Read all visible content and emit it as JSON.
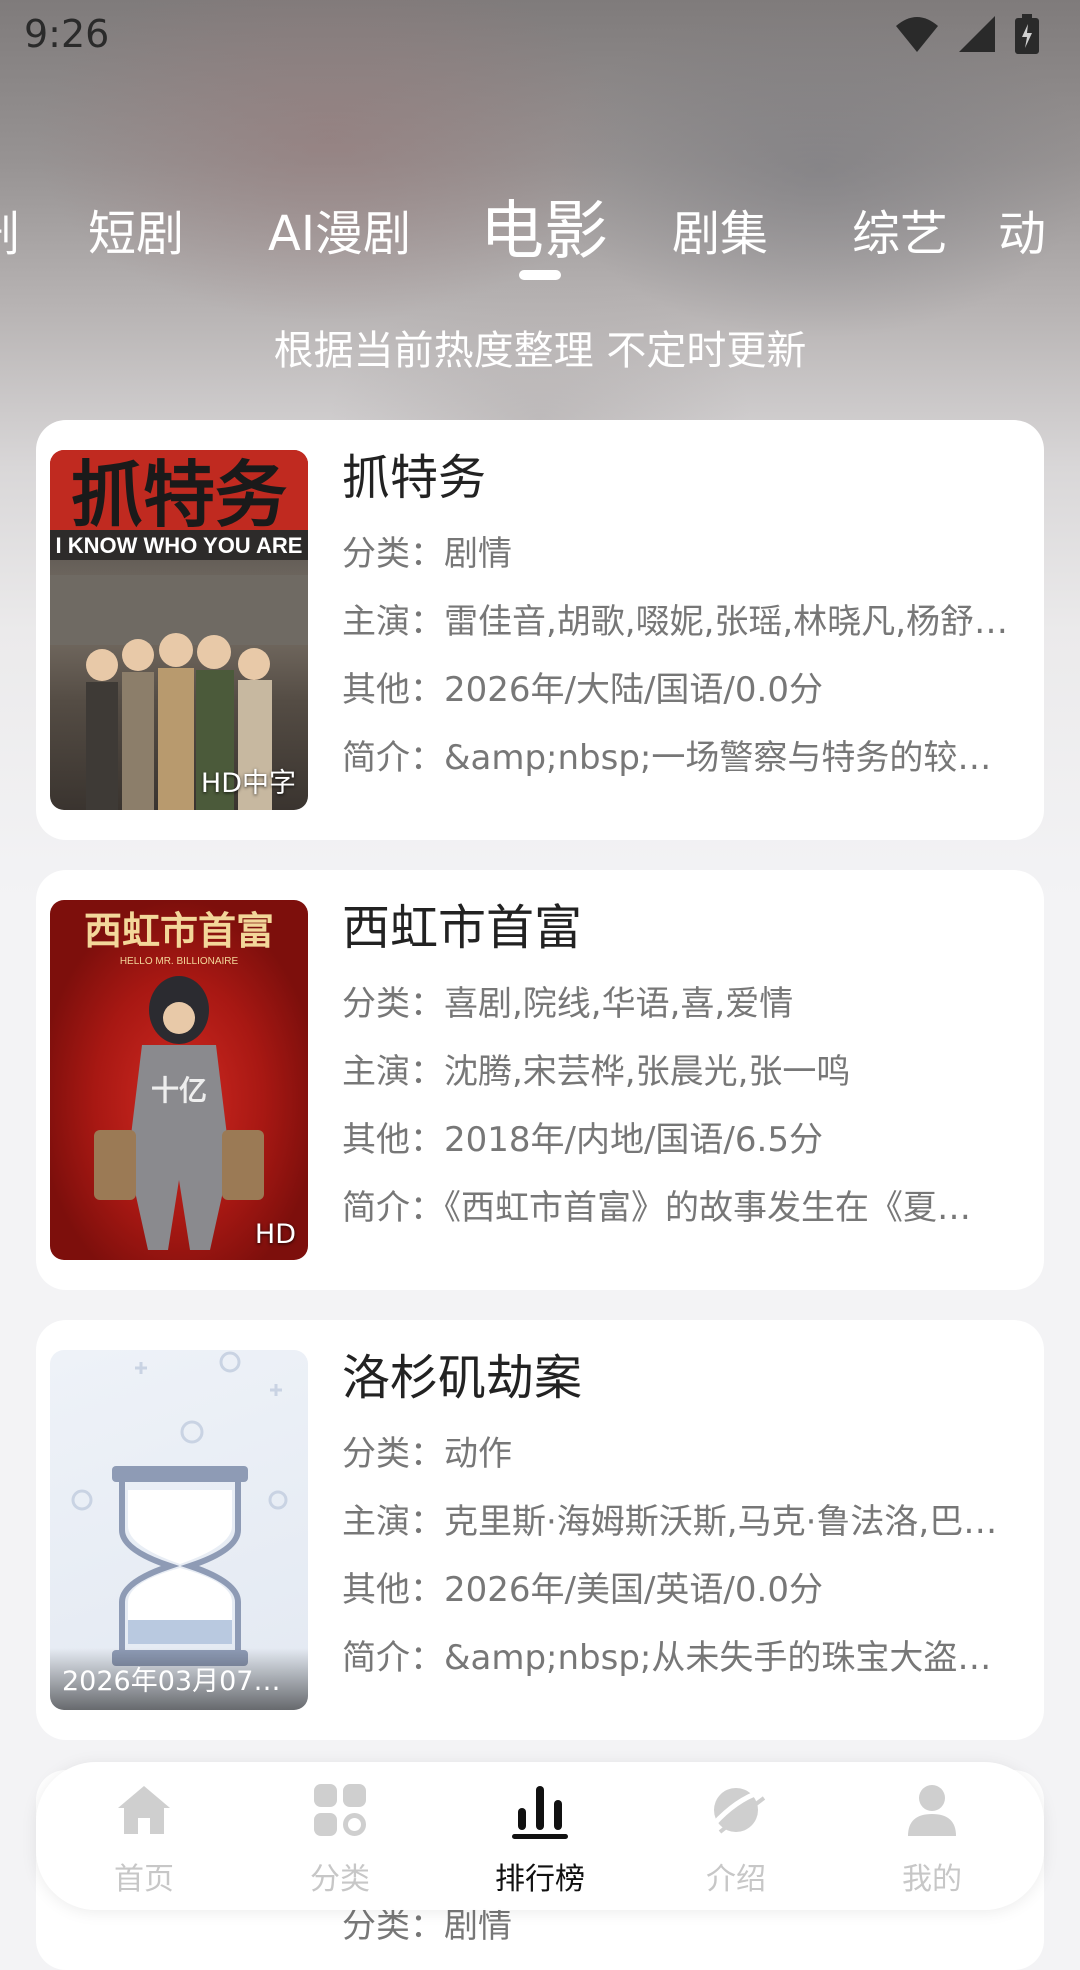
{
  "status_bar": {
    "time": "9:26"
  },
  "tabs": {
    "items": [
      {
        "label": "剧"
      },
      {
        "label": "短剧"
      },
      {
        "label": "AI漫剧"
      },
      {
        "label": "电影"
      },
      {
        "label": "剧集"
      },
      {
        "label": "综艺"
      },
      {
        "label": "动"
      }
    ],
    "active_index": 3
  },
  "subtitle": "根据当前热度整理 不定时更新",
  "labels": {
    "category": "分类：",
    "cast": "主演：",
    "other": "其他：",
    "intro": "简介："
  },
  "cards": [
    {
      "title": "抓特务",
      "category": "剧情",
      "cast": "雷佳音,胡歌,啜妮,张瑶,林晓凡,杨舒…",
      "other": "2026年/大陆/国语/0.0分",
      "intro": "&amp;nbsp;一场警察与特务的较量…",
      "badge": "HD中字",
      "poster_text": "抓特务",
      "poster_sub": "I KNOW WHO YOU ARE"
    },
    {
      "title": "西虹市首富",
      "category": "喜剧,院线,华语,喜,爱情",
      "cast": "沈腾,宋芸桦,张晨光,张一鸣",
      "other": "2018年/内地/国语/6.5分",
      "intro": "《西虹市首富》的故事发生在《夏…",
      "badge": "HD",
      "poster_text": "西虹市首富",
      "poster_sub": "HELLO MR. BILLIONAIRE"
    },
    {
      "title": "洛杉矶劫案",
      "category": "动作",
      "cast": "克里斯·海姆斯沃斯,马克·鲁法洛,巴…",
      "other": "2026年/美国/英语/0.0分",
      "intro": "&amp;nbsp;从未失手的珠宝大盗，…",
      "date": "2026年03月07日…"
    }
  ],
  "peek": {
    "text": "分类：剧情"
  },
  "bottom_nav": {
    "items": [
      {
        "label": "首页",
        "icon": "home-icon"
      },
      {
        "label": "分类",
        "icon": "category-icon"
      },
      {
        "label": "排行榜",
        "icon": "ranking-icon"
      },
      {
        "label": "介绍",
        "icon": "planet-icon"
      },
      {
        "label": "我的",
        "icon": "profile-icon"
      }
    ],
    "active_index": 2
  }
}
